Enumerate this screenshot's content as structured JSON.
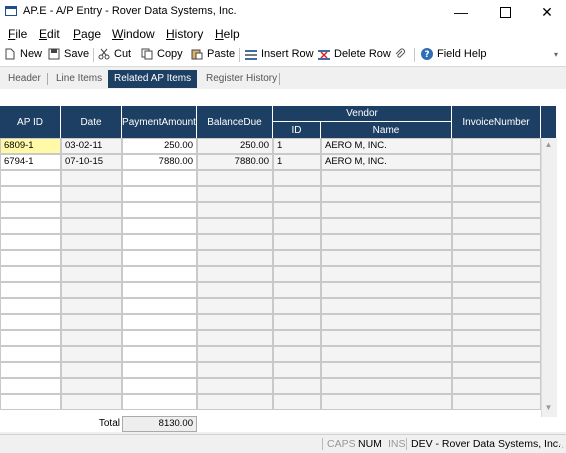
{
  "window": {
    "title": "AP.E - A/P Entry - Rover Data Systems, Inc."
  },
  "menu": [
    {
      "label": "File"
    },
    {
      "label": "Edit"
    },
    {
      "label": "Page"
    },
    {
      "label": "Window"
    },
    {
      "label": "History"
    },
    {
      "label": "Help"
    }
  ],
  "toolbar": {
    "new": "New",
    "save": "Save",
    "cut": "Cut",
    "copy": "Copy",
    "paste": "Paste",
    "insert_row": "Insert Row",
    "delete_row": "Delete Row",
    "field_help": "Field Help"
  },
  "tabs": [
    {
      "label": "Header",
      "active": false
    },
    {
      "label": "Line Items",
      "active": false
    },
    {
      "label": "Related AP Items",
      "active": true
    },
    {
      "label": "Register History",
      "active": false
    }
  ],
  "grid": {
    "columns": {
      "ap_id": "AP ID",
      "date": "Date",
      "payment_amount": "PaymentAmount",
      "balance_due": "BalanceDue",
      "vendor": "Vendor",
      "vendor_id": "ID",
      "vendor_name": "Name",
      "invoice_number": "InvoiceNumber"
    },
    "rows": [
      {
        "ap_id": "6809-1",
        "date": "03-02-11",
        "payment_amount": "250.00",
        "balance_due": "250.00",
        "vendor_id": "1",
        "vendor_name": "AERO M, INC.",
        "invoice_number": ""
      },
      {
        "ap_id": "6794-1",
        "date": "07-10-15",
        "payment_amount": "7880.00",
        "balance_due": "7880.00",
        "vendor_id": "1",
        "vendor_name": "AERO M, INC.",
        "invoice_number": ""
      }
    ],
    "total_label": "Total",
    "total_value": "8130.00"
  },
  "statusbar": {
    "caps": "CAPS",
    "num": "NUM",
    "ins": "INS",
    "info": "DEV - Rover Data Systems, Inc."
  },
  "colors": {
    "header_bg": "#1d3f63",
    "selected_cell": "#fff9a8"
  }
}
